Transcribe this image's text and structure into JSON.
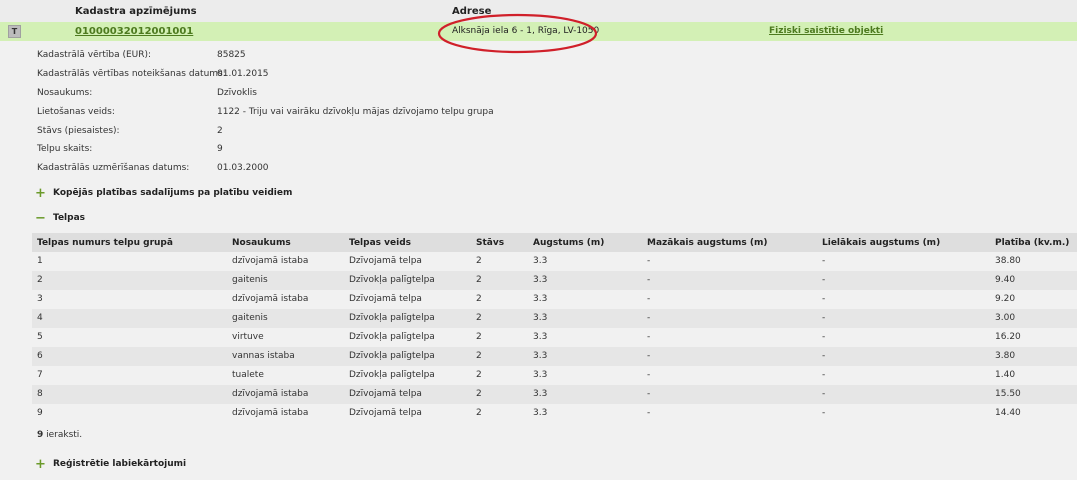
{
  "header": {
    "cadastre_label": "Kadastra apzīmējums",
    "address_label": "Adrese"
  },
  "record": {
    "type_badge": "T",
    "cadastre_number": "01000032012001001",
    "address": "Alksnāja iela 6 - 1, Rīga, LV-1050",
    "linked_objects_link": "Fiziski saistītie objekti",
    "annotation_color": "#d0202a"
  },
  "properties": [
    {
      "label": "Kadastrālā vērtība (EUR):",
      "value": "85825"
    },
    {
      "label": "Kadastrālās vērtības noteikšanas datums:",
      "value": "01.01.2015"
    },
    {
      "label": "Nosaukums:",
      "value": "Dzīvoklis"
    },
    {
      "label": "Lietošanas veids:",
      "value": "1122 - Triju vai vairāku dzīvokļu mājas dzīvojamo telpu grupa"
    },
    {
      "label": "Stāvs (piesaistes):",
      "value": "2"
    },
    {
      "label": "Telpu skaits:",
      "value": "9"
    },
    {
      "label": "Kadastrālās uzmērīšanas datums:",
      "value": "01.03.2000"
    }
  ],
  "sections": {
    "area_breakdown": {
      "toggle": "+",
      "label": "Kopējās platības sadalījums pa platību veidiem"
    },
    "rooms": {
      "toggle": "−",
      "label": "Telpas"
    },
    "improvements": {
      "toggle": "+",
      "label": "Reģistrētie labiekārtojumi"
    }
  },
  "rooms_table": {
    "columns": [
      "Telpas numurs telpu grupā",
      "Nosaukums",
      "Telpas veids",
      "Stāvs",
      "Augstums (m)",
      "Mazākais augstums (m)",
      "Lielākais augstums (m)",
      "Platība (kv.m.)"
    ],
    "rows": [
      [
        "1",
        "dzīvojamā istaba",
        "Dzīvojamā telpa",
        "2",
        "3.3",
        "-",
        "-",
        "38.80"
      ],
      [
        "2",
        "gaitenis",
        "Dzīvokļa palīgtelpa",
        "2",
        "3.3",
        "-",
        "-",
        "9.40"
      ],
      [
        "3",
        "dzīvojamā istaba",
        "Dzīvojamā telpa",
        "2",
        "3.3",
        "-",
        "-",
        "9.20"
      ],
      [
        "4",
        "gaitenis",
        "Dzīvokļa palīgtelpa",
        "2",
        "3.3",
        "-",
        "-",
        "3.00"
      ],
      [
        "5",
        "virtuve",
        "Dzīvokļa palīgtelpa",
        "2",
        "3.3",
        "-",
        "-",
        "16.20"
      ],
      [
        "6",
        "vannas istaba",
        "Dzīvokļa palīgtelpa",
        "2",
        "3.3",
        "-",
        "-",
        "3.80"
      ],
      [
        "7",
        "tualete",
        "Dzīvokļa palīgtelpa",
        "2",
        "3.3",
        "-",
        "-",
        "1.40"
      ],
      [
        "8",
        "dzīvojamā istaba",
        "Dzīvojamā telpa",
        "2",
        "3.3",
        "-",
        "-",
        "15.50"
      ],
      [
        "9",
        "dzīvojamā istaba",
        "Dzīvojamā telpa",
        "2",
        "3.3",
        "-",
        "-",
        "14.40"
      ]
    ],
    "record_count": "9",
    "record_count_suffix": " ieraksti."
  }
}
